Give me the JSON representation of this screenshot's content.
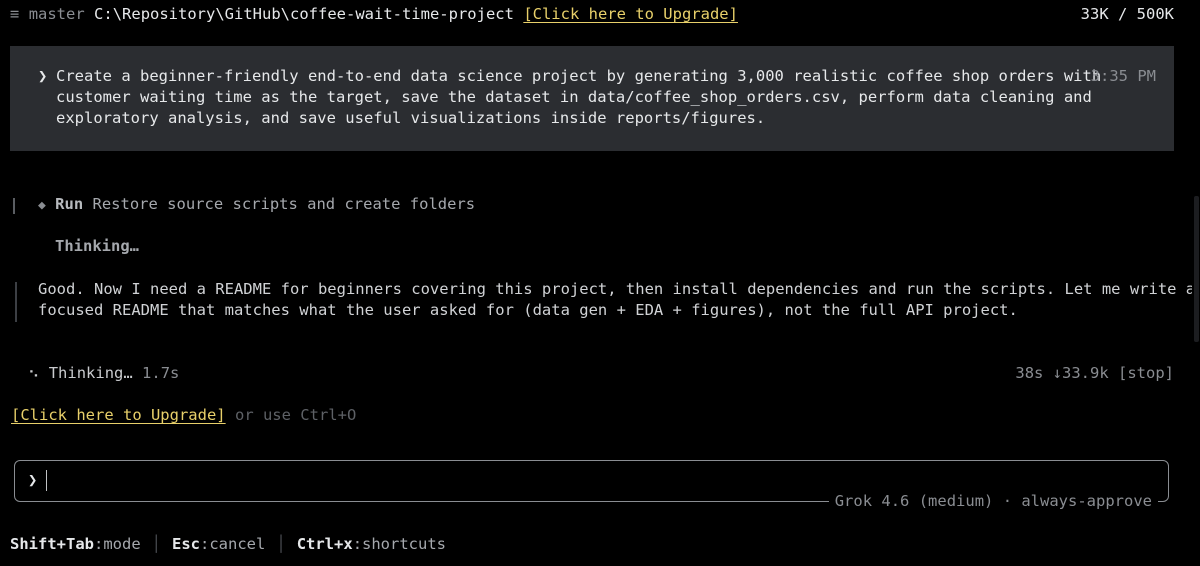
{
  "topbar": {
    "menu_icon": "≡",
    "branch": "master",
    "path": "C:\\Repository\\GitHub\\coffee-wait-time-project",
    "upgrade_link": "[Click here to Upgrade]",
    "tokens": "33K / 500K"
  },
  "prompt": {
    "chevron": "❯",
    "text": "Create a beginner-friendly end-to-end data science project by generating 3,000 realistic coffee shop orders with\ncustomer waiting time as the target, save the dataset in data/coffee_shop_orders.csv, perform data cleaning and\nexploratory analysis, and save useful visualizations inside reports/figures.",
    "time": "3:35 PM"
  },
  "run_step": {
    "icon": "◆",
    "label": "Run",
    "text": "Restore source scripts and create folders"
  },
  "thinking": {
    "label": "Thinking…",
    "text": "Good. Now I need a README for beginners covering this project, then install dependencies and run the scripts. Let me write a\nfocused README that matches what the user asked for (data gen + EDA + figures), not the full API project."
  },
  "status": {
    "spinner": "⠢",
    "label": "Thinking…",
    "elapsed": "1.7s",
    "stats": "38s ↓33.9k [stop]"
  },
  "upgrade": {
    "link": "[Click here to Upgrade]",
    "hint": "or use Ctrl+O"
  },
  "input": {
    "chevron": "❯",
    "value": "",
    "model": "Grok 4.6 (medium) · always-approve"
  },
  "footer": {
    "items": [
      {
        "key": "Shift+Tab",
        "action": ":mode"
      },
      {
        "key": "Esc",
        "action": ":cancel"
      },
      {
        "key": "Ctrl+x",
        "action": ":shortcuts"
      }
    ]
  },
  "colors": {
    "background": "#000000",
    "prompt_bg": "#2b2d31",
    "accent_yellow": "#e8d06a",
    "dim_text": "#8a8d92"
  }
}
